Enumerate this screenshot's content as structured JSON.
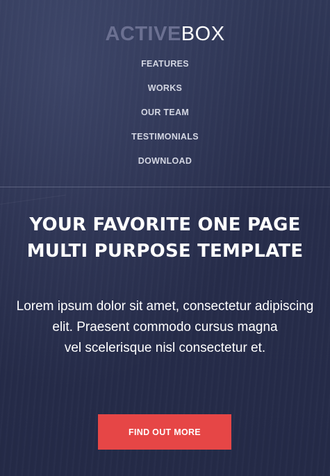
{
  "brand": {
    "logo_bold": "ACTIVE",
    "logo_light": "BOX"
  },
  "nav": {
    "items": [
      "FEATURES",
      "WORKS",
      "OUR TEAM",
      "TESTIMONIALS",
      "DOWNLOAD"
    ]
  },
  "hero": {
    "title_line1": "YOUR FAVORITE ONE PAGE",
    "title_line2": "MULTI PURPOSE TEMPLATE",
    "text_line1": "Lorem ipsum dolor sit amet, consectetur adipiscing",
    "text_line2": "elit. Praesent commodo cursus magna",
    "text_line3": "vel scelerisque nisl consectetur et.",
    "cta_label": "FIND OUT MORE"
  },
  "colors": {
    "background": "#2a3050",
    "accent": "#e64646",
    "logo_muted": "#6b7091",
    "nav_text": "#d3d6e2"
  }
}
